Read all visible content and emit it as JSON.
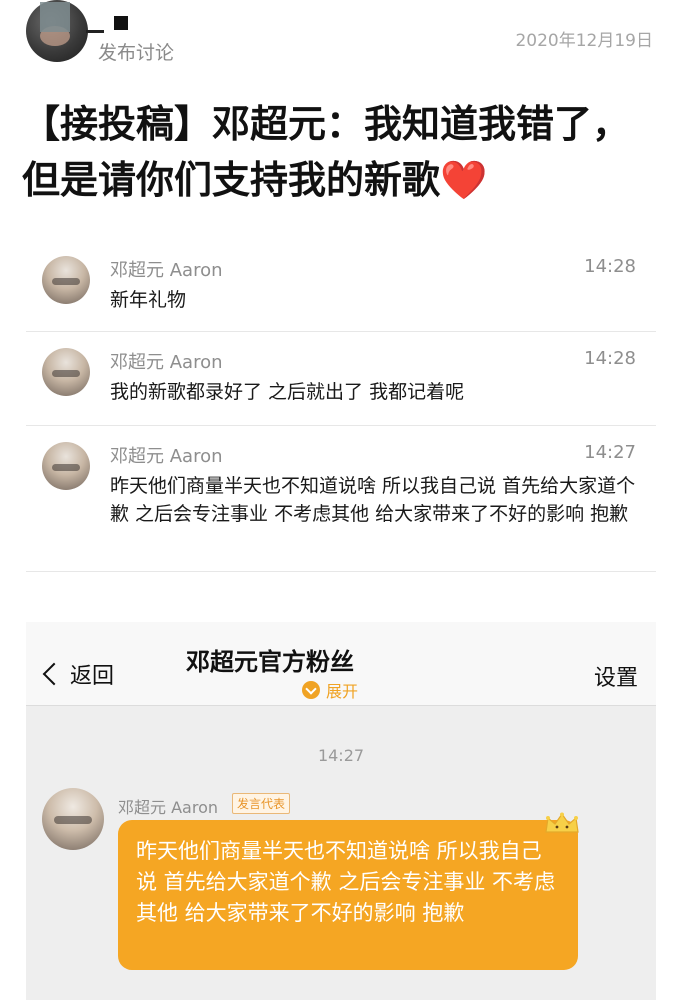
{
  "post": {
    "action": "发布讨论",
    "date": "2020年12月19日",
    "title": "【接投稿】邓超元：我知道我错了，但是请你们支持我的新歌",
    "title_emoji": "❤️"
  },
  "chat_list": [
    {
      "name": "邓超元 Aaron",
      "time": "14:28",
      "message": "新年礼物"
    },
    {
      "name": "邓超元 Aaron",
      "time": "14:28",
      "message": "我的新歌都录好了 之后就出了 我都记着呢"
    },
    {
      "name": "邓超元 Aaron",
      "time": "14:27",
      "message": "昨天他们商量半天也不知道说啥 所以我自己说 首先给大家道个歉 之后会专注事业 不考虑其他 给大家带来了不好的影响 抱歉"
    }
  ],
  "group_chat": {
    "back_label": "返回",
    "title": "邓超元官方粉丝",
    "expand_label": "展开",
    "settings_label": "设置",
    "timestamp": "14:27",
    "sender": "邓超元 Aaron",
    "role_badge": "发言代表",
    "message": "昨天他们商量半天也不知道说啥 所以我自己说 首先给大家道个歉 之后会专注事业 不考虑其他 给大家带来了不好的影响 抱歉",
    "bubble_color": "#f5a623",
    "accent_color": "#f0a324"
  }
}
